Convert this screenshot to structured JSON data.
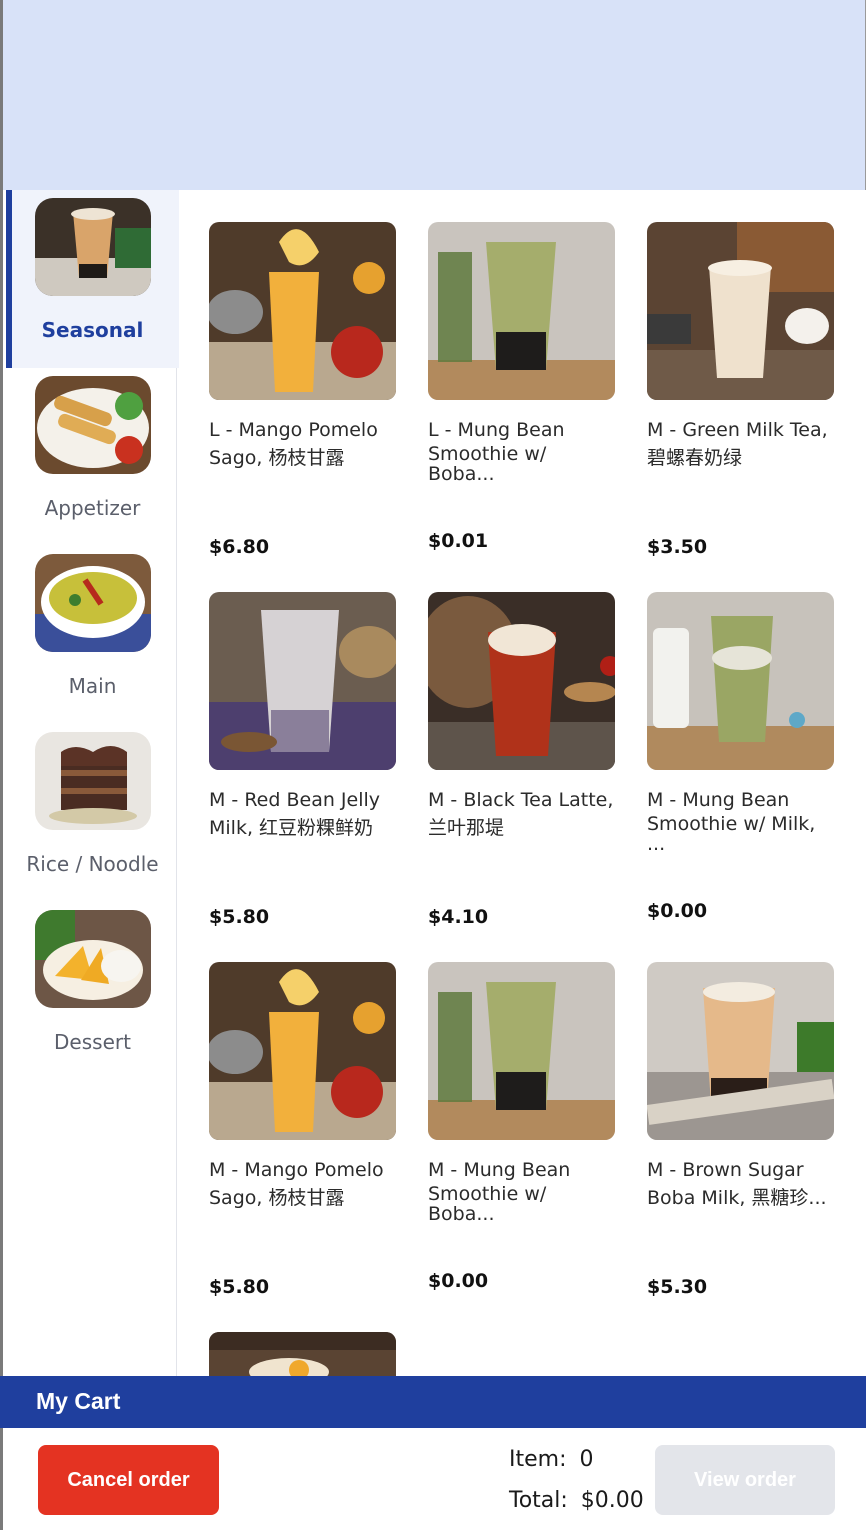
{
  "categories": [
    {
      "label": "Seasonal",
      "active": true
    },
    {
      "label": "Appetizer",
      "active": false
    },
    {
      "label": "Main",
      "active": false
    },
    {
      "label": "Rice / Noodle",
      "active": false
    },
    {
      "label": "Dessert",
      "active": false
    }
  ],
  "items": [
    {
      "line1": "L - Mango Pomelo",
      "line2": "Sago, 杨枝甘露",
      "price": "$6.80"
    },
    {
      "line1": "L - Mung Bean",
      "line2": "Smoothie w/ Boba...",
      "price": "$0.01"
    },
    {
      "line1": "M - Green Milk Tea,",
      "line2": "碧螺春奶绿",
      "price": "$3.50"
    },
    {
      "line1": "M - Red Bean Jelly",
      "line2": "Milk, 红豆粉粿鲜奶",
      "price": "$5.80"
    },
    {
      "line1": "M - Black Tea Latte,",
      "line2": "兰叶那堤",
      "price": "$4.10"
    },
    {
      "line1": "M - Mung Bean",
      "line2": "Smoothie w/ Milk, ...",
      "price": "$0.00"
    },
    {
      "line1": "M - Mango Pomelo",
      "line2": "Sago, 杨枝甘露",
      "price": "$5.80"
    },
    {
      "line1": "M - Mung Bean",
      "line2": "Smoothie w/ Boba...",
      "price": "$0.00"
    },
    {
      "line1": "M - Brown Sugar",
      "line2": "Boba Milk, 黑糖珍...",
      "price": "$5.30"
    }
  ],
  "cart": {
    "title": "My Cart",
    "cancel_label": "Cancel order",
    "item_label": "Item:",
    "item_count": "0",
    "total_label": "Total:",
    "total_value": "$0.00",
    "view_label": "View order"
  },
  "colors": {
    "banner": "#d8e2f8",
    "accent": "#1f3f9e",
    "cancel": "#e43322",
    "disabled": "#e3e5ea"
  }
}
